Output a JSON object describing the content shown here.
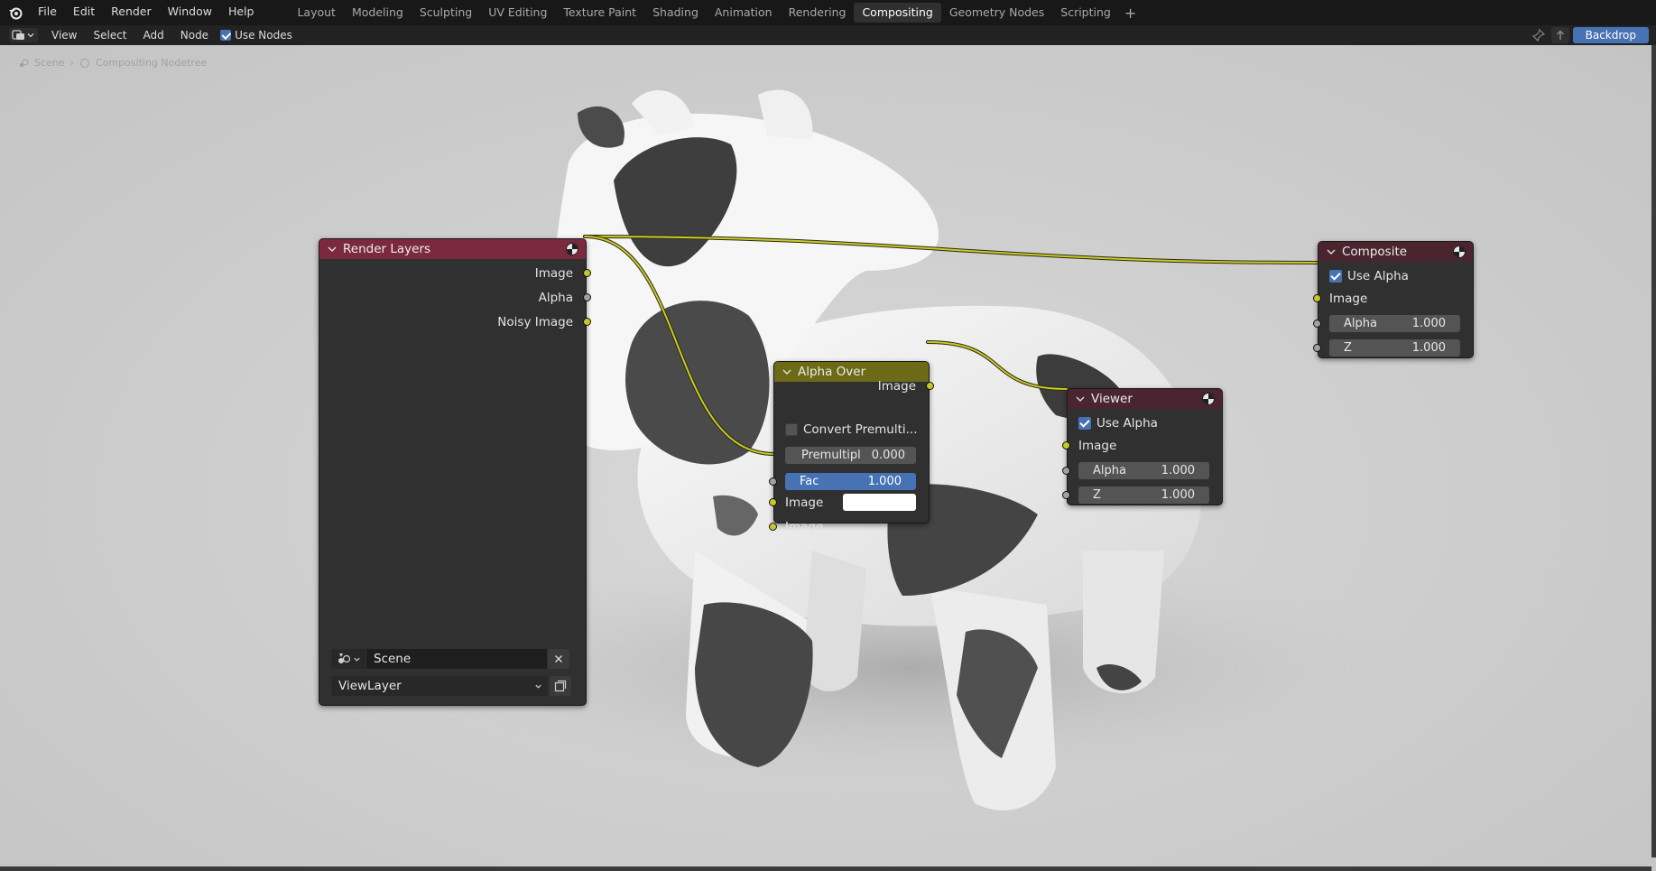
{
  "topbar": {
    "menus": [
      "File",
      "Edit",
      "Render",
      "Window",
      "Help"
    ],
    "workspaces": [
      "Layout",
      "Modeling",
      "Sculpting",
      "UV Editing",
      "Texture Paint",
      "Shading",
      "Animation",
      "Rendering",
      "Compositing",
      "Geometry Nodes",
      "Scripting"
    ],
    "active_workspace": "Compositing",
    "add_tab": "+"
  },
  "header": {
    "menus": [
      "View",
      "Select",
      "Add",
      "Node"
    ],
    "use_nodes_label": "Use Nodes",
    "use_nodes_checked": true,
    "backdrop_label": "Backdrop"
  },
  "breadcrumb": {
    "scene": "Scene",
    "tree": "Compositing Nodetree"
  },
  "nodes": {
    "render_layers": {
      "title": "Render Layers",
      "outputs": [
        "Image",
        "Alpha",
        "Noisy Image"
      ],
      "scene_value": "Scene",
      "view_layer_value": "ViewLayer"
    },
    "alpha_over": {
      "title": "Alpha Over",
      "output": "Image",
      "convert_label": "Convert Premulti...",
      "convert_checked": false,
      "premul_label": "Premultipl",
      "premul_value": "0.000",
      "fac_label": "Fac",
      "fac_value": "1.000",
      "input1_label": "Image",
      "input2_label": "Image",
      "input1_color": "#ffffff"
    },
    "composite": {
      "title": "Composite",
      "use_alpha_label": "Use Alpha",
      "use_alpha_checked": true,
      "image_label": "Image",
      "alpha_label": "Alpha",
      "alpha_value": "1.000",
      "z_label": "Z",
      "z_value": "1.000"
    },
    "viewer": {
      "title": "Viewer",
      "use_alpha_label": "Use Alpha",
      "use_alpha_checked": true,
      "image_label": "Image",
      "alpha_label": "Alpha",
      "alpha_value": "1.000",
      "z_label": "Z",
      "z_value": "1.000"
    }
  },
  "colors": {
    "accent": "#4772b3",
    "socket_color": "#c7c729",
    "render_layers_header": "#7b2a3d",
    "alpha_over_header": "#6c6a16",
    "output_header": "#4a2530"
  }
}
